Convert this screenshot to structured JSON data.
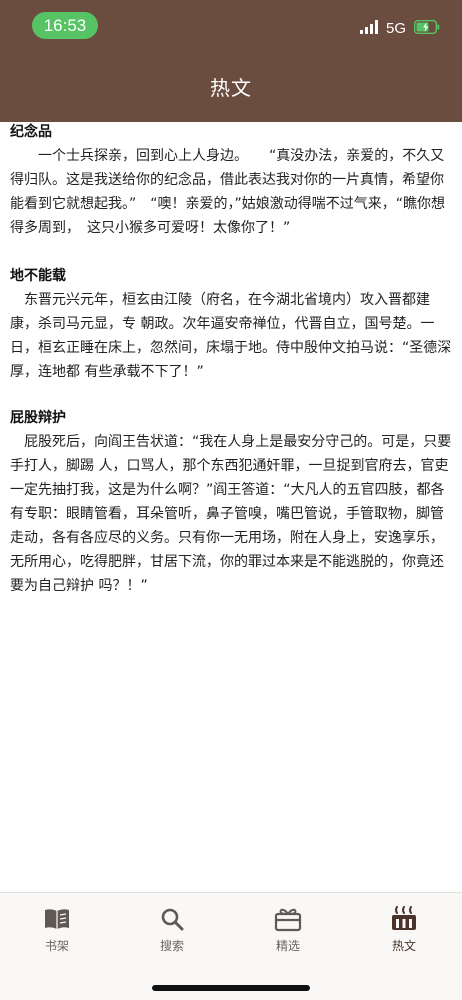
{
  "status": {
    "time": "16:53",
    "network": "5G"
  },
  "header": {
    "title": "热文"
  },
  "articles": [
    {
      "title": "纪念品",
      "body": "一个士兵探亲，回到心上人身边。　　“真没办法，亲爱的，不久又得归队。这是我送给你的纪念品，借此表达我对你的一片真情，希望你能看到它就想起我。”　“噢！亲爱的，”姑娘激动得喘不过气来，“瞧你想得多周到，　这只小猴多可爱呀！太像你了！”"
    },
    {
      "title": "地不能载",
      "body": "东晋元兴元年，桓玄由江陵（府名，在今湖北省境内）攻入晋都建康，杀司马元显，专 朝政。次年逼安帝禅位，代晋自立，国号楚。一日，桓玄正睡在床上，忽然间，床塌于地。侍中殷仲文拍马说：“圣德深厚，连地都 有些承载不下了！”"
    },
    {
      "title": "屁股辩护",
      "body": "屁股死后，向阎王告状道：“我在人身上是最安分守己的。可是，只要手打人，脚踢 人，口骂人，那个东西犯通奸罪，一旦捉到官府去，官吏一定先抽打我，这是为什么啊？”阎王答道：“大凡人的五官四肢，都各有专职：眼睛管看，耳朵管听，鼻子管嗅，嘴巴管说，手管取物，脚管走动，各有各应尽的义务。只有你一无用场，附在人身上，安逸享乐，　无所用心，吃得肥胖，甘居下流，你的罪过本来是不能逃脱的，你竟还要为自己辩护 吗？！”"
    }
  ],
  "tabbar": {
    "items": [
      {
        "label": "书架",
        "icon": "book-icon"
      },
      {
        "label": "搜索",
        "icon": "search-icon"
      },
      {
        "label": "精选",
        "icon": "gift-icon"
      },
      {
        "label": "热文",
        "icon": "hot-icon"
      }
    ],
    "active": "热文"
  },
  "colors": {
    "header_bg": "#6b4d3f",
    "time_pill": "#56c465",
    "battery": "#56c465"
  }
}
